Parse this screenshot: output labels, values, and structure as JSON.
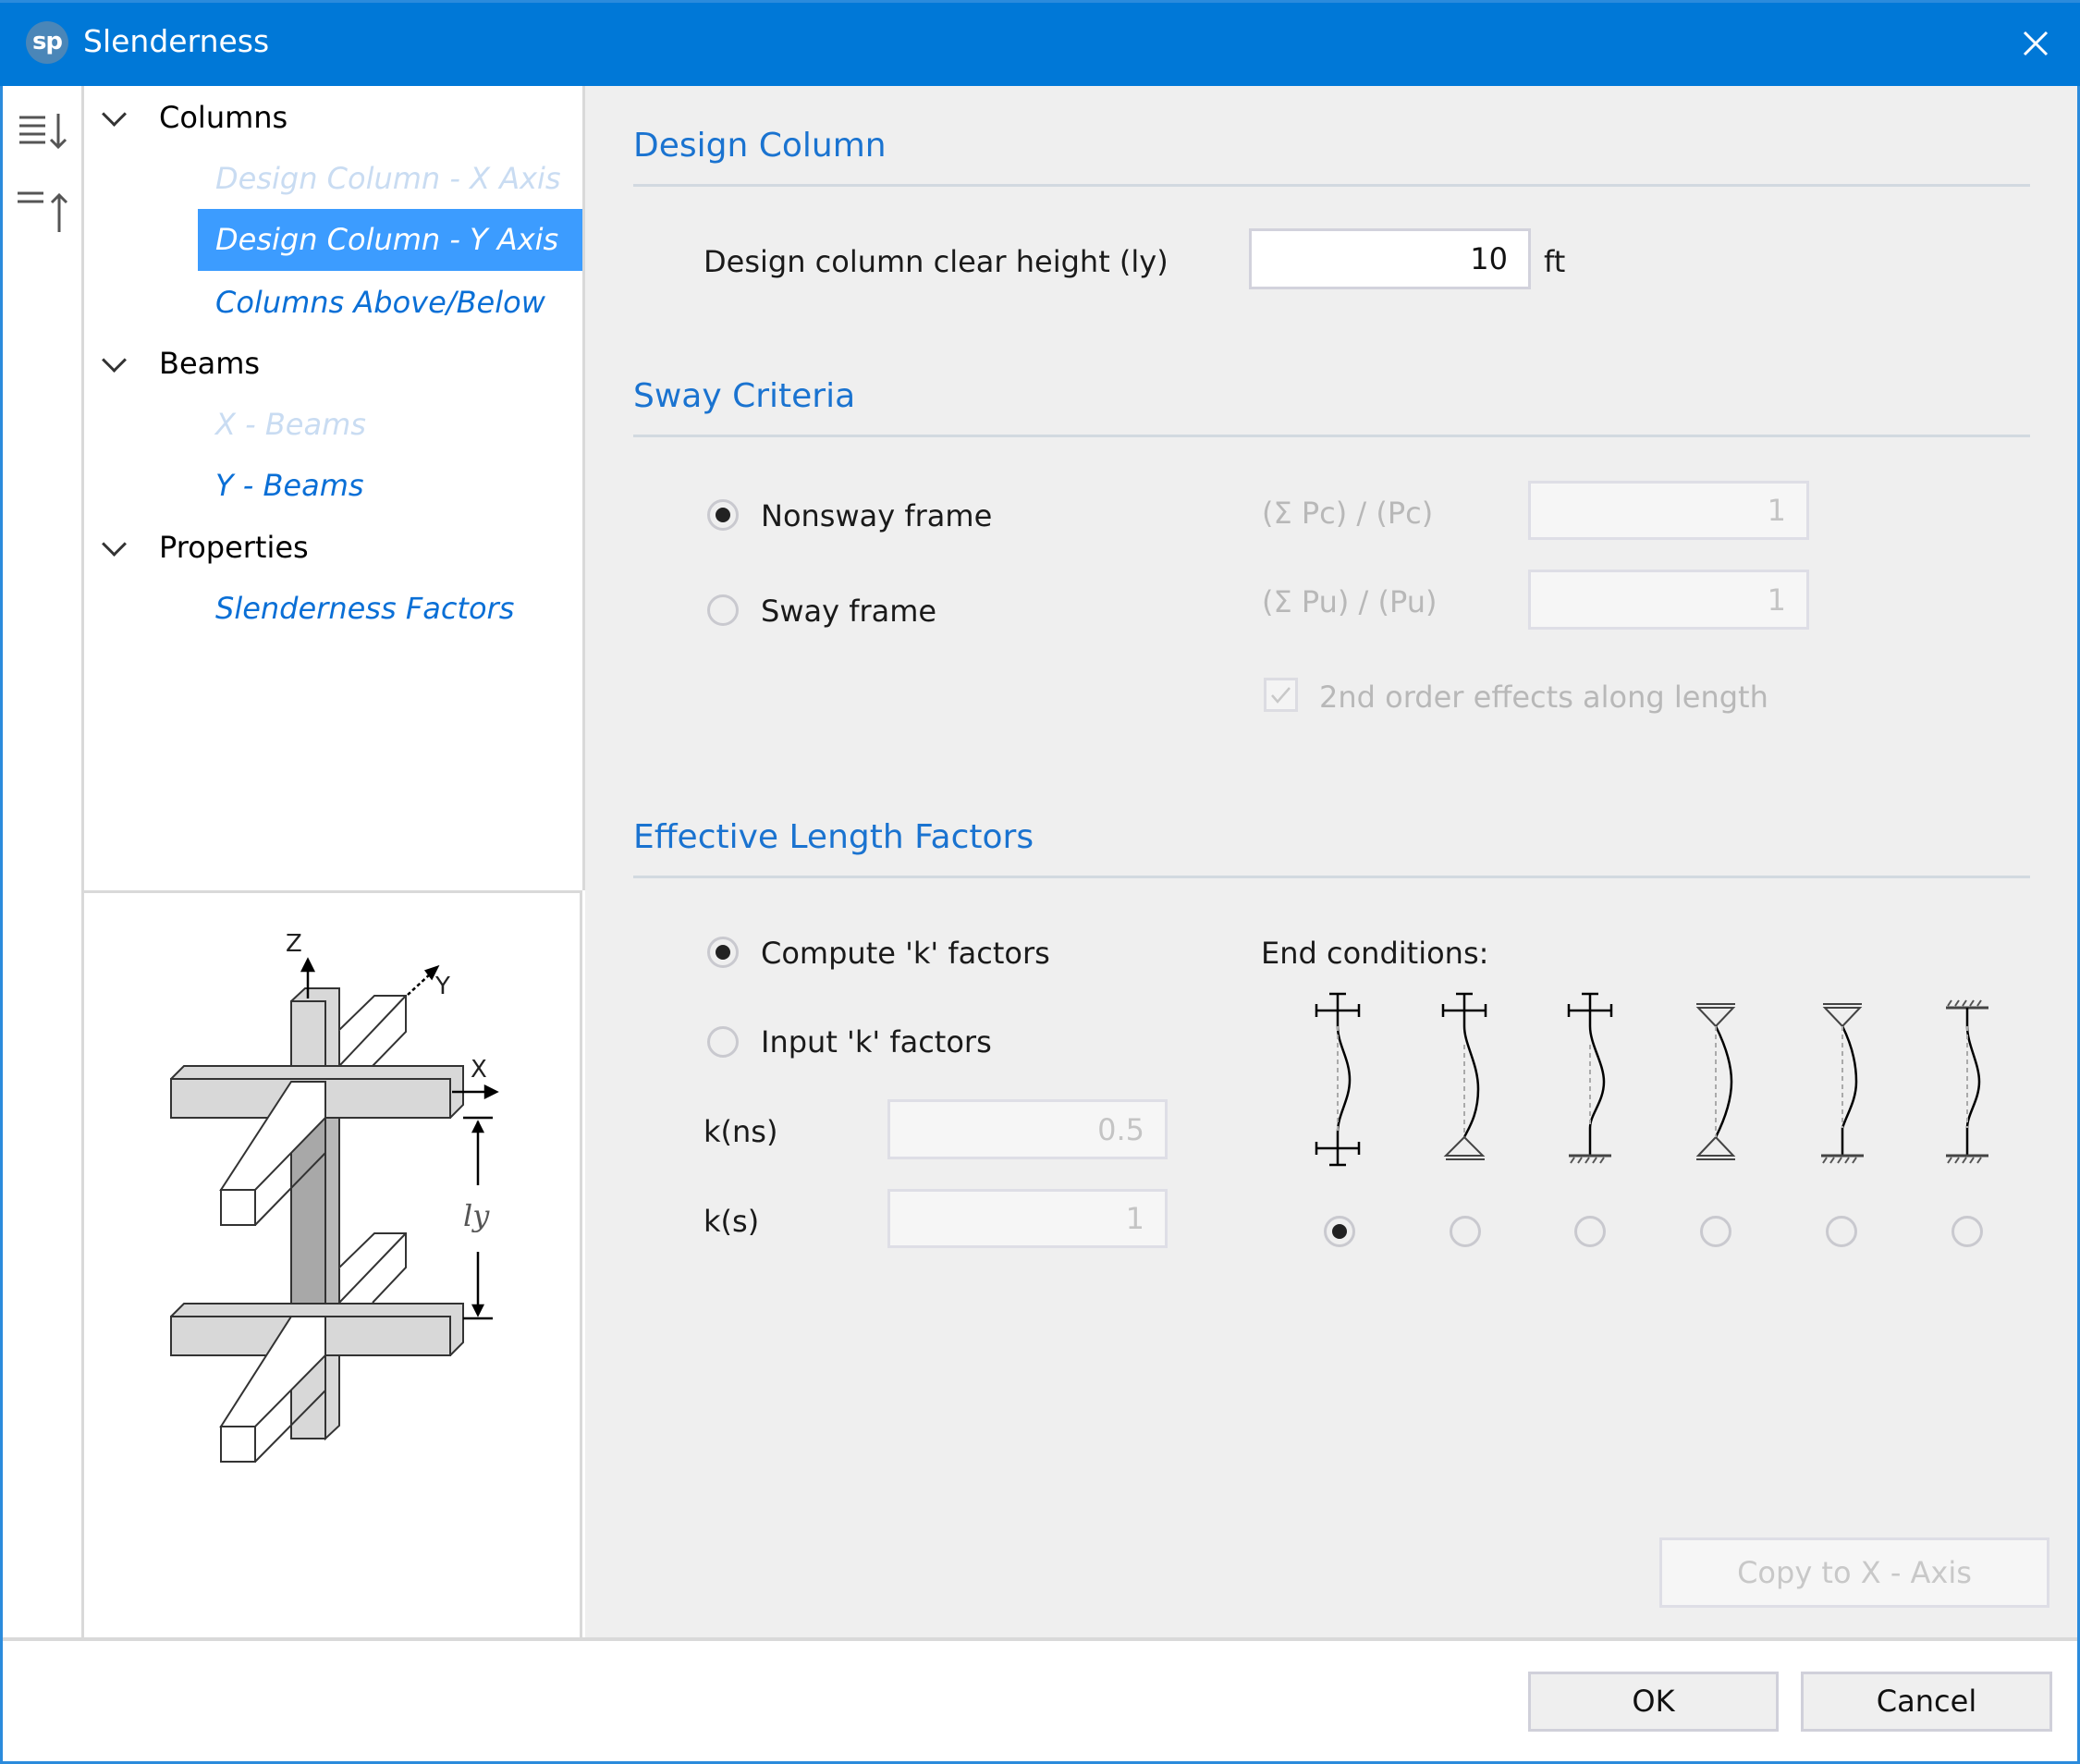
{
  "window": {
    "title": "Slenderness",
    "logo_text": "sp",
    "accent": "#0078d7"
  },
  "toolbar": {
    "expand_all_icon": "expand-all-icon",
    "collapse_all_icon": "collapse-all-icon"
  },
  "tree": {
    "groups": [
      {
        "label": "Columns",
        "children": [
          {
            "label": "Design Column - X Axis",
            "state": "disabled"
          },
          {
            "label": "Design Column - Y Axis",
            "state": "selected"
          },
          {
            "label": "Columns Above/Below",
            "state": "normal"
          }
        ]
      },
      {
        "label": "Beams",
        "children": [
          {
            "label": "X - Beams",
            "state": "disabled"
          },
          {
            "label": "Y - Beams",
            "state": "normal"
          }
        ]
      },
      {
        "label": "Properties",
        "children": [
          {
            "label": "Slenderness Factors",
            "state": "normal"
          }
        ]
      }
    ]
  },
  "diagram": {
    "axis_z": "Z",
    "axis_y": "Y",
    "axis_x": "X",
    "dimension_label": "ly"
  },
  "design_column": {
    "heading": "Design Column",
    "clear_height_label": "Design column clear height (ly)",
    "clear_height_value": "10",
    "clear_height_unit": "ft"
  },
  "sway_criteria": {
    "heading": "Sway Criteria",
    "options": [
      {
        "label": "Nonsway frame",
        "selected": true
      },
      {
        "label": "Sway frame",
        "selected": false
      }
    ],
    "pc_ratio_label": "(Σ Pc) / (Pc)",
    "pc_ratio_value": "1",
    "pu_ratio_label": "(Σ Pu) / (Pu)",
    "pu_ratio_value": "1",
    "second_order_label": "2nd order effects along length",
    "second_order_checked": true
  },
  "effective_length": {
    "heading": "Effective Length Factors",
    "options": [
      {
        "label": "Compute 'k' factors",
        "selected": true
      },
      {
        "label": "Input 'k' factors",
        "selected": false
      }
    ],
    "kns_label": "k(ns)",
    "kns_value": "0.5",
    "ks_label": "k(s)",
    "ks_value": "1",
    "end_conditions_label": "End conditions:",
    "end_conditions": [
      {
        "name": "free-free",
        "selected": true
      },
      {
        "name": "free-pinned",
        "selected": false
      },
      {
        "name": "free-fixed",
        "selected": false
      },
      {
        "name": "pinned-pinned",
        "selected": false
      },
      {
        "name": "pinned-fixed",
        "selected": false
      },
      {
        "name": "fixed-fixed",
        "selected": false
      }
    ]
  },
  "buttons": {
    "copy": "Copy to X - Axis",
    "ok": "OK",
    "cancel": "Cancel"
  }
}
